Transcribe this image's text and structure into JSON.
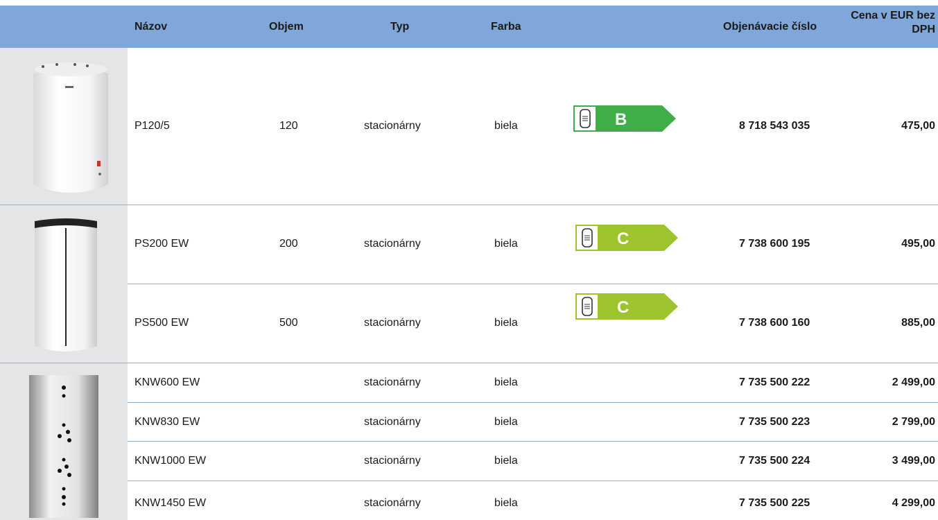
{
  "header": {
    "name": "Názov",
    "volume": "Objem",
    "type": "Typ",
    "color": "Farba",
    "order_number": "Objenávacie číslo",
    "price_line1": "Cena v EUR bez",
    "price_line2": "DPH"
  },
  "rows": [
    {
      "name": "P120/5",
      "volume": "120",
      "type": "stacionárny",
      "color": "biela",
      "energy_class": "B",
      "order_number": "8 718 543 035",
      "price": "475,00"
    },
    {
      "name": "PS200 EW",
      "volume": "200",
      "type": "stacionárny",
      "color": "biela",
      "energy_class": "C",
      "order_number": "7 738 600 195",
      "price": "495,00"
    },
    {
      "name": "PS500 EW",
      "volume": "500",
      "type": "stacionárny",
      "color": "biela",
      "energy_class": "C",
      "order_number": "7 738 600 160",
      "price": "885,00"
    },
    {
      "name": "KNW600 EW",
      "volume": "",
      "type": "stacionárny",
      "color": "biela",
      "energy_class": "",
      "order_number": "7 735 500 222",
      "price": "2 499,00"
    },
    {
      "name": "KNW830 EW",
      "volume": "",
      "type": "stacionárny",
      "color": "biela",
      "energy_class": "",
      "order_number": "7 735 500 223",
      "price": "2 799,00"
    },
    {
      "name": "KNW1000 EW",
      "volume": "",
      "type": "stacionárny",
      "color": "biela",
      "energy_class": "",
      "order_number": "7 735 500 224",
      "price": "3 499,00"
    },
    {
      "name": "KNW1450 EW",
      "volume": "",
      "type": "stacionárny",
      "color": "biela",
      "energy_class": "",
      "order_number": "7 735 500 225",
      "price": "4 299,00"
    }
  ],
  "colors": {
    "header_bg": "#7fa7d9",
    "class_b": "#3fae49",
    "class_c": "#9dc42c",
    "separator": "#8fb0d8",
    "image_bg": "#e4e5e6"
  },
  "icons": [
    "water-tank-icon"
  ]
}
